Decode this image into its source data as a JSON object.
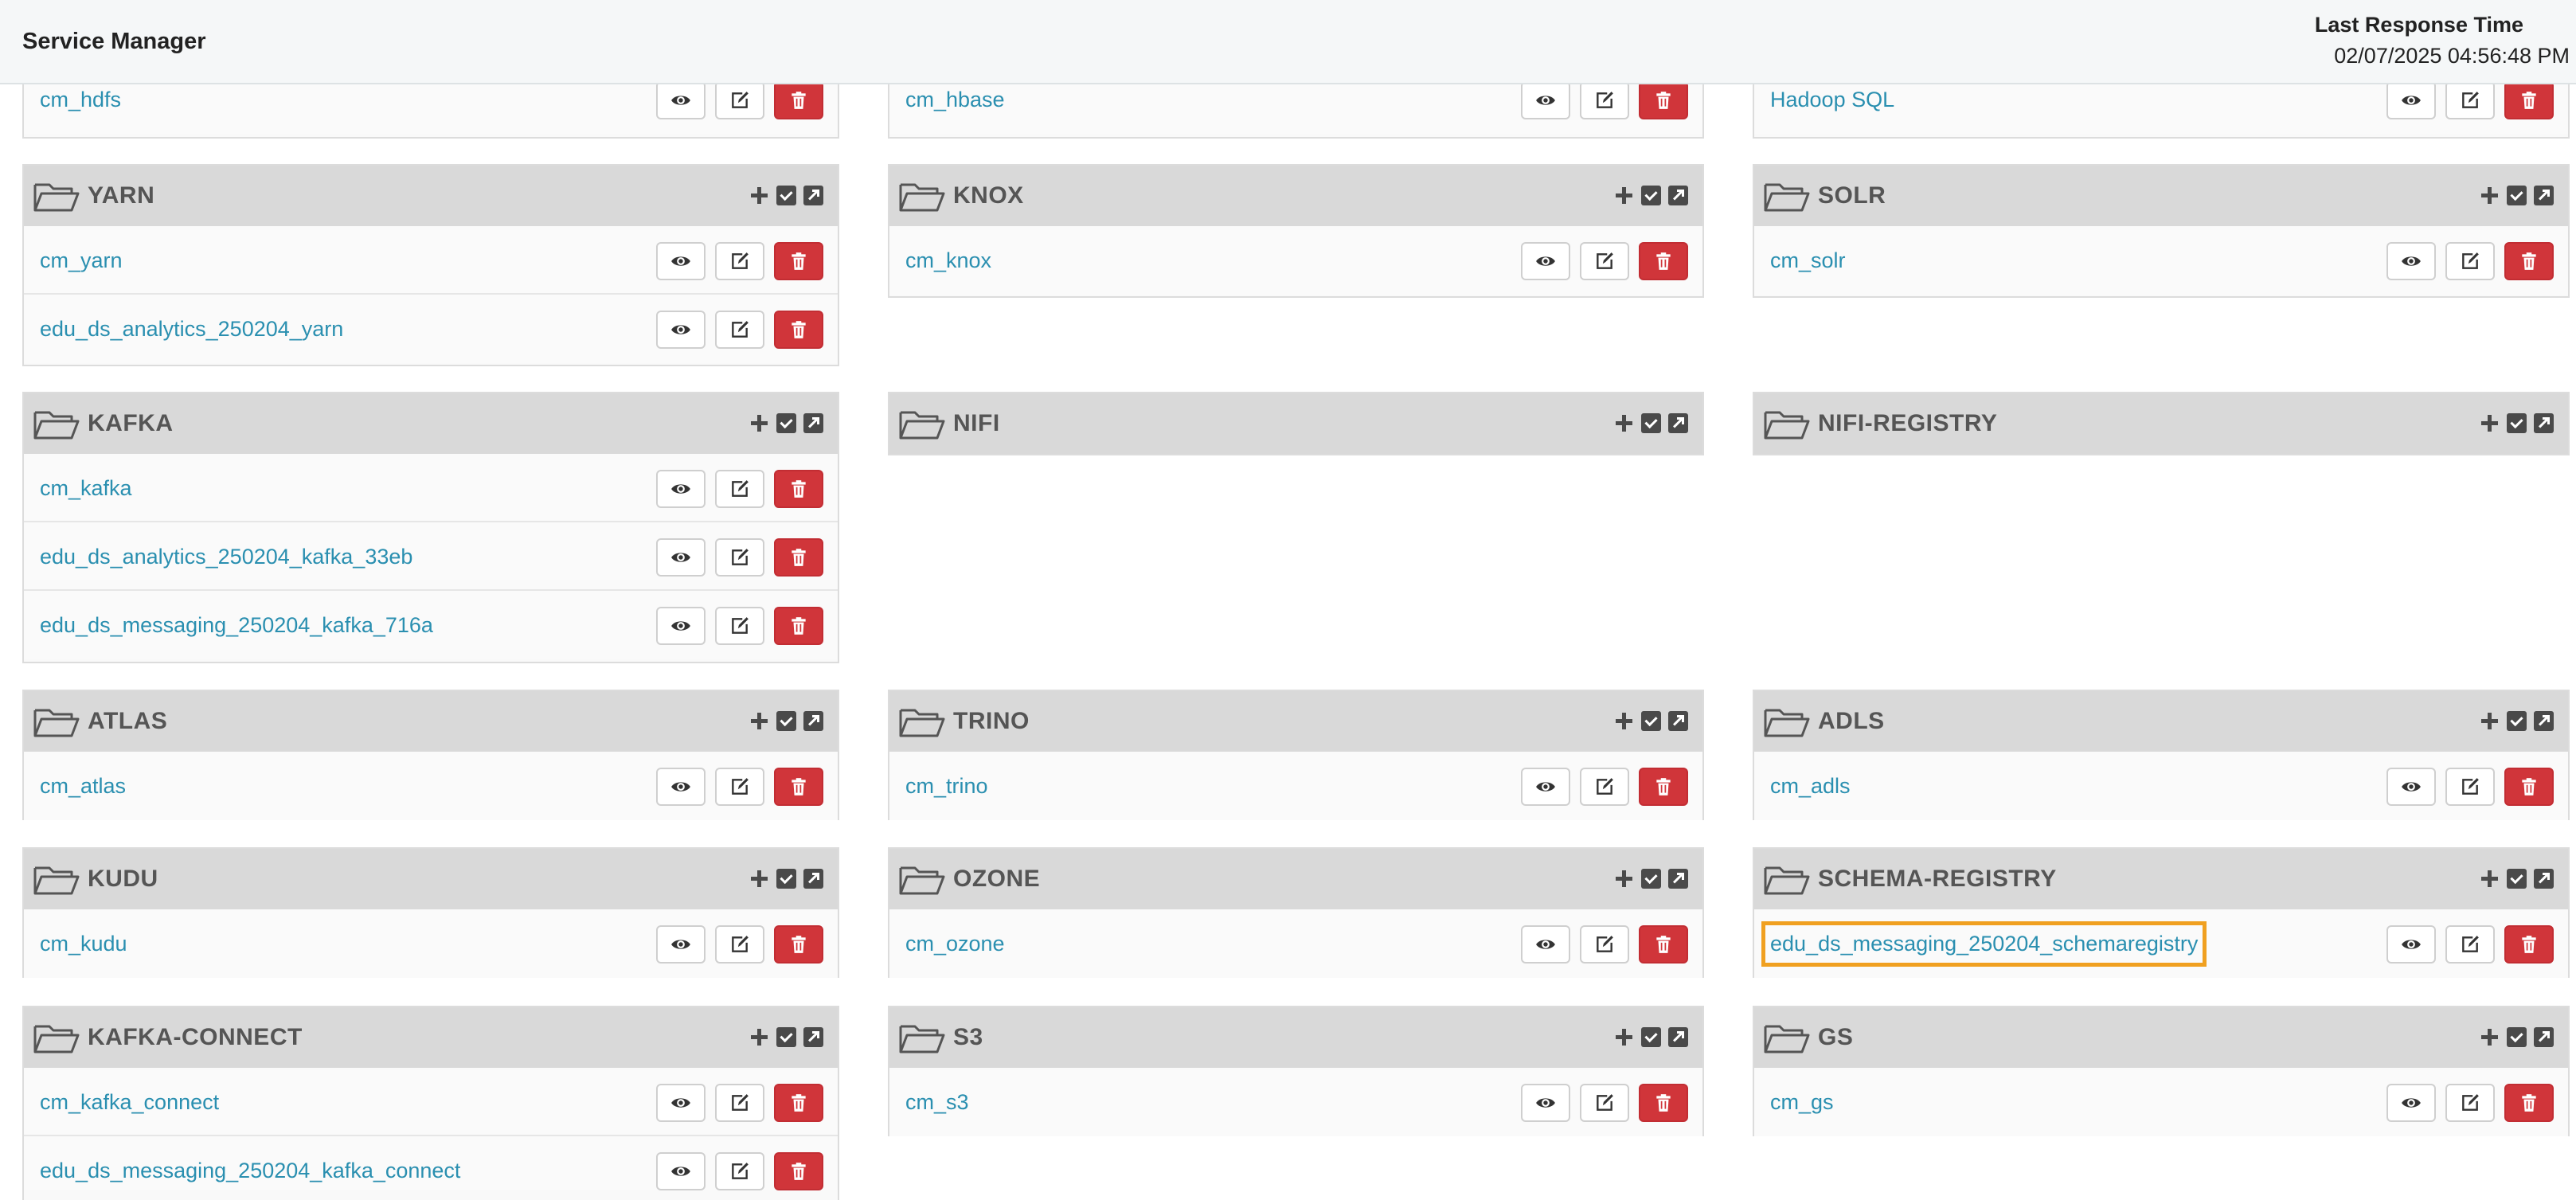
{
  "header": {
    "title": "Service Manager",
    "last_response_label": "Last Response Time",
    "last_response_value": "02/07/2025 04:56:48 PM"
  },
  "icons": {
    "group_folder": "folder-open-icon",
    "add": "plus-icon",
    "edit_group": "check-square-icon",
    "open_group": "external-link-square-icon",
    "view": "eye-icon",
    "edit": "edit-icon",
    "delete": "trash-icon"
  },
  "colors": {
    "link": "#2a8fb0",
    "delete_button": "#d0353a",
    "highlight_outline": "#f0a020",
    "panel_header": "#d9d9d9"
  },
  "groups": [
    {
      "name": "",
      "services": [
        "cm_hdfs"
      ]
    },
    {
      "name": "",
      "services": [
        "cm_hbase"
      ]
    },
    {
      "name": "",
      "services": [
        "Hadoop SQL"
      ]
    },
    {
      "name": "YARN",
      "services": [
        "cm_yarn",
        "edu_ds_analytics_250204_yarn"
      ]
    },
    {
      "name": "KNOX",
      "services": [
        "cm_knox"
      ]
    },
    {
      "name": "SOLR",
      "services": [
        "cm_solr"
      ]
    },
    {
      "name": "KAFKA",
      "services": [
        "cm_kafka",
        "edu_ds_analytics_250204_kafka_33eb",
        "edu_ds_messaging_250204_kafka_716a"
      ]
    },
    {
      "name": "NIFI",
      "services": []
    },
    {
      "name": "NIFI-REGISTRY",
      "services": []
    },
    {
      "name": "ATLAS",
      "services": [
        "cm_atlas"
      ]
    },
    {
      "name": "TRINO",
      "services": [
        "cm_trino"
      ]
    },
    {
      "name": "ADLS",
      "services": [
        "cm_adls"
      ]
    },
    {
      "name": "KUDU",
      "services": [
        "cm_kudu"
      ]
    },
    {
      "name": "OZONE",
      "services": [
        "cm_ozone"
      ]
    },
    {
      "name": "SCHEMA-REGISTRY",
      "services": [
        "edu_ds_messaging_250204_schemaregistry"
      ]
    },
    {
      "name": "KAFKA-CONNECT",
      "services": [
        "cm_kafka_connect",
        "edu_ds_messaging_250204_kafka_connect"
      ]
    },
    {
      "name": "S3",
      "services": [
        "cm_s3"
      ]
    },
    {
      "name": "GS",
      "services": [
        "cm_gs"
      ]
    }
  ]
}
